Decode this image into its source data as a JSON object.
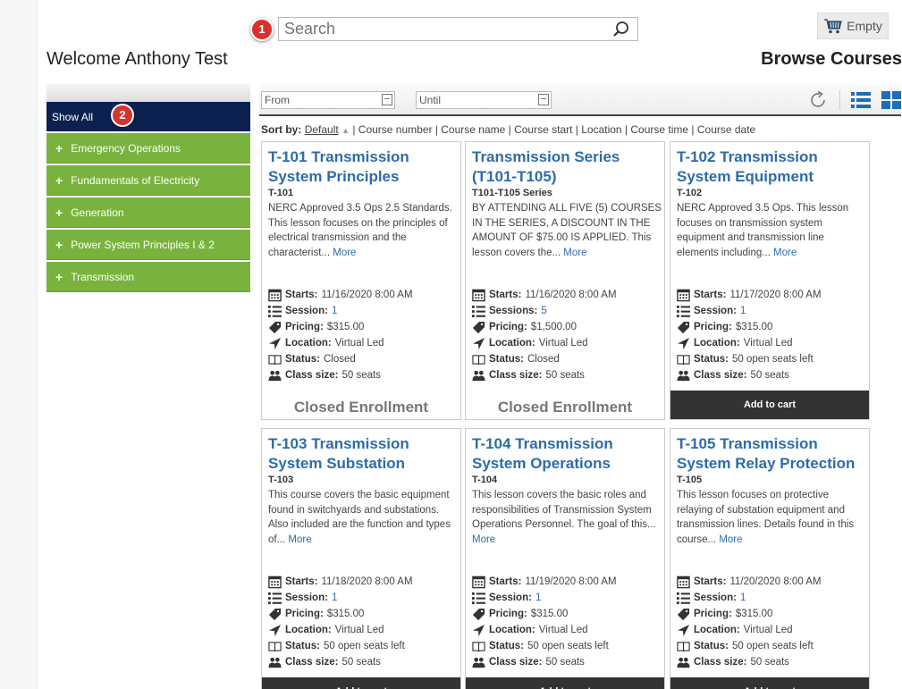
{
  "header": {
    "search_placeholder": "Search",
    "cart_label": "Empty",
    "welcome": "Welcome Anthony Test",
    "page_title": "Browse Courses",
    "badge_1": "1",
    "badge_2": "2"
  },
  "sidebar": {
    "show_all": "Show All",
    "categories": [
      {
        "label": "Emergency Operations"
      },
      {
        "label": "Fundamentals of Electricity"
      },
      {
        "label": "Generation"
      },
      {
        "label": "Power System Principles I & 2"
      },
      {
        "label": "Transmission"
      }
    ]
  },
  "filters": {
    "from_placeholder": "From",
    "until_placeholder": "Until"
  },
  "sort": {
    "label": "Sort by:",
    "default": "Default",
    "options": "| Course number | Course name | Course start | Location | Course time | Course date"
  },
  "labels": {
    "starts": "Starts:",
    "session": "Session:",
    "sessions": "Sessions:",
    "pricing": "Pricing:",
    "location": "Location:",
    "status": "Status:",
    "class_size": "Class size:",
    "more": "More",
    "closed_enrollment": "Closed Enrollment",
    "add_to_cart": "Add to cart"
  },
  "courses": [
    {
      "title": "T-101 Transmission System Principles",
      "code": "T-101",
      "desc": "NERC Approved 3.5 Ops 2.5 Standards. This lesson focuses on the principles of electrical transmission and the characterist...",
      "starts": "11/16/2020 8:00 AM",
      "session": "1",
      "pricing": "$315.00",
      "location": "Virtual Led",
      "status": "Closed",
      "class_size": "50 seats"
    },
    {
      "title": "Transmission Series (T101-T105)",
      "code": "T101-T105 Series",
      "desc": "BY ATTENDING ALL FIVE (5) COURSES IN THE SERIES, A DISCOUNT IN THE AMOUNT OF $75.00 IS APPLIED. This lesson covers the...",
      "starts": "11/16/2020 8:00 AM",
      "session": "5",
      "pricing": "$1,500.00",
      "location": "Virtual Led",
      "status": "Closed",
      "class_size": "50 seats"
    },
    {
      "title": "T-102 Transmission System Equipment",
      "code": "T-102",
      "desc": "NERC Approved 3.5 Ops.  This lesson focuses on transmission system equipment and transmission line elements including...",
      "starts": "11/17/2020 8:00 AM",
      "session": "1",
      "pricing": "$315.00",
      "location": "Virtual Led",
      "status": "50 open seats left",
      "class_size": "50 seats"
    },
    {
      "title": "T-103 Transmission System Substation",
      "code": "T-103",
      "desc": "This course covers the basic equipment found in switchyards and substations. Also included are the function and types of...",
      "starts": "11/18/2020 8:00 AM",
      "session": "1",
      "pricing": "$315.00",
      "location": "Virtual Led",
      "status": "50 open seats left",
      "class_size": "50 seats"
    },
    {
      "title": "T-104 Transmission System Operations",
      "code": "T-104",
      "desc": "This lesson covers the basic roles and responsibilities of Transmission System Operations Personnel. The goal of this...",
      "starts": "11/19/2020 8:00 AM",
      "session": "1",
      "pricing": "$315.00",
      "location": "Virtual Led",
      "status": "50 open seats left",
      "class_size": "50 seats"
    },
    {
      "title": "T-105 Transmission System Relay Protection",
      "code": "T-105",
      "desc": "This lesson focuses on protective relaying of substation equipment and transmission lines. Details found in this course...",
      "starts": "11/20/2020 8:00 AM",
      "session": "1",
      "pricing": "$315.00",
      "location": "Virtual Led",
      "status": "50 open seats left",
      "class_size": "50 seats"
    }
  ]
}
